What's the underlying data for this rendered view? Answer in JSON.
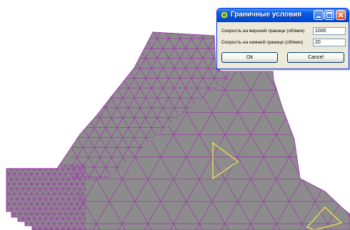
{
  "dialog": {
    "title": "Граничные условия",
    "upper_label": "Скорость на верхней границе (об/мин)",
    "upper_value": "1000",
    "lower_label": "Скорость на нижней границе (об/мин)",
    "lower_value": "20",
    "ok_label": "Ok",
    "cancel_label": "Cancel",
    "title_icon": "app-icon",
    "minimize_icon": "minimize-icon",
    "maximize_icon": "maximize-icon",
    "close_icon": "close-icon"
  },
  "mesh": {
    "fill_color": "#8c8c8c",
    "edge_color": "#9b3fa8",
    "highlight_color": "#e8e84a"
  }
}
